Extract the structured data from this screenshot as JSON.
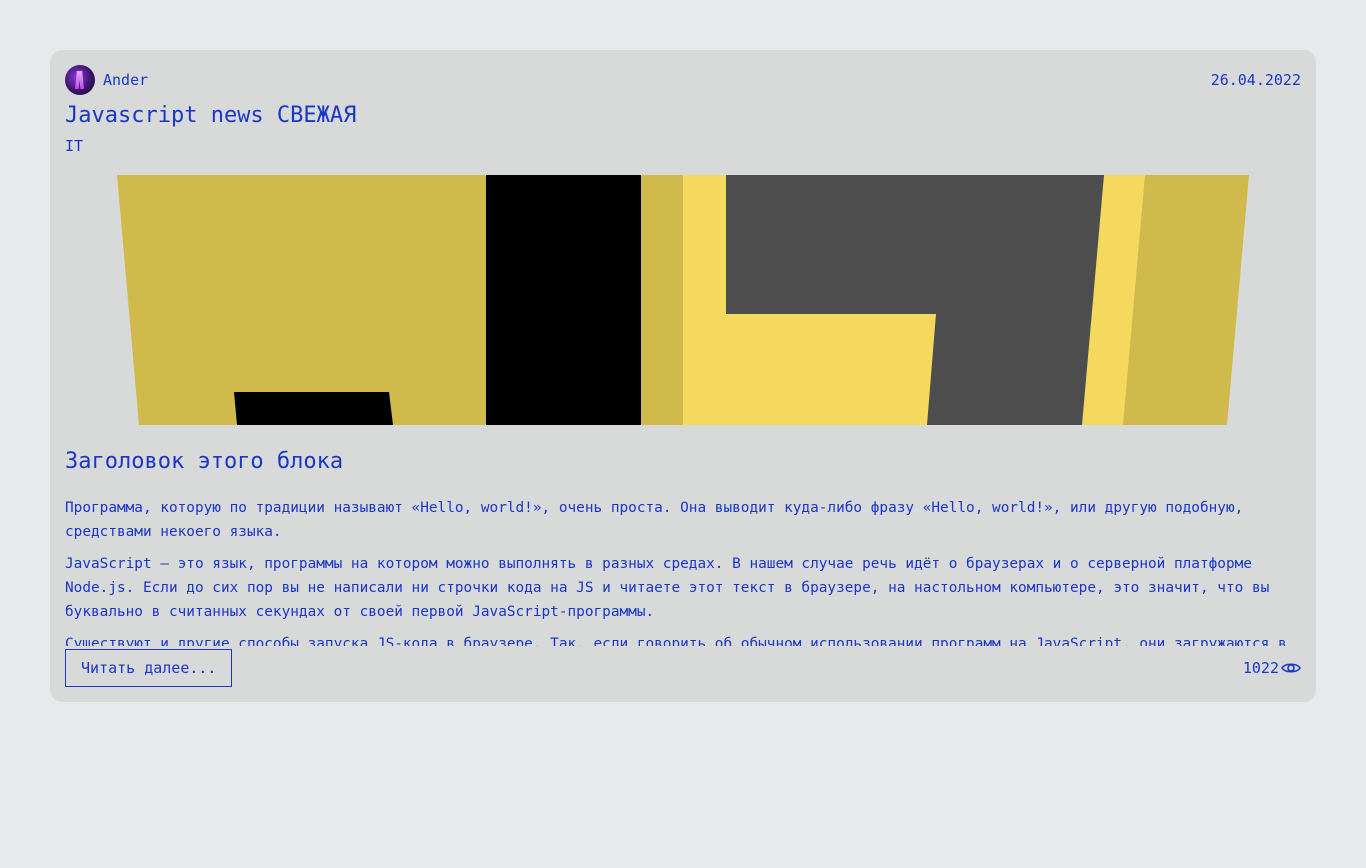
{
  "post": {
    "author": {
      "name": "Ander",
      "avatar": "avatar-image"
    },
    "date": "26.04.2022",
    "title": "Javascript news СВЕЖАЯ",
    "category": "IT",
    "section_heading": "Заголовок этого блока",
    "paragraphs": [
      "Программа, которую по традиции называют «Hello, world!», очень проста. Она выводит куда-либо фразу «Hello, world!», или другую подобную, средствами некоего языка.",
      "JavaScript — это язык, программы на котором можно выполнять в разных средах. В нашем случае речь идёт о браузерах и о серверной платформе Node.js. Если до сих пор вы не написали ни строчки кода на JS и читаете этот текст в браузере, на настольном компьютере, это значит, что вы буквально в считанных секундах от своей первой JavaScript-программы.",
      "Существуют и другие способы запуска JS-кода в браузере. Так, если говорить об обычном использовании программ на JavaScript, они загружаются в браузер для обеспечения работы веб-страниц."
    ],
    "read_more_label": "Читать далее...",
    "views": "1022",
    "views_icon": "eye-icon"
  },
  "colors": {
    "background": "#e8e9eb",
    "card": "#d8dad9",
    "text": "#1a36c8",
    "js_yellow_dark": "#d0ba4c",
    "js_yellow_light": "#f5d85e",
    "js_black": "#000000",
    "js_gray": "#4d4d4d"
  }
}
